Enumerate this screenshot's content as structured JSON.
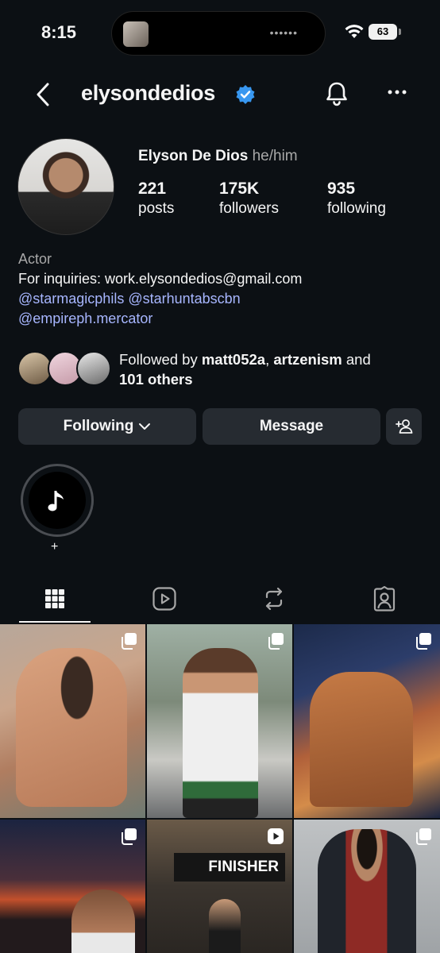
{
  "status_bar": {
    "time": "8:15",
    "battery": "63"
  },
  "header": {
    "username": "elysondedios"
  },
  "profile": {
    "name": "Elyson De Dios",
    "pronouns": "he/him",
    "stats": [
      {
        "value": "221",
        "label": "posts"
      },
      {
        "value": "175K",
        "label": "followers"
      },
      {
        "value": "935",
        "label": "following"
      }
    ]
  },
  "bio": {
    "category": "Actor",
    "line1": "For inquiries: work.elysondedios@gmail.com",
    "mention1": "@starmagicphils",
    "mention2": "@starhuntabscbn",
    "mention3": "@empireph.mercator"
  },
  "followed_by": {
    "prefix": "Followed by ",
    "user1": "matt052a",
    "sep": ", ",
    "user2": "artzenism",
    "and": " and",
    "others": "101 others"
  },
  "buttons": {
    "following": "Following",
    "message": "Message"
  },
  "highlight": {
    "label": "+"
  },
  "grid": {
    "posts": [
      {
        "type": "carousel"
      },
      {
        "type": "carousel"
      },
      {
        "type": "carousel"
      },
      {
        "type": "carousel"
      },
      {
        "type": "reel",
        "sign_text": "FINISHER"
      },
      {
        "type": "carousel"
      }
    ]
  },
  "colors": {
    "background": "#0c1014",
    "button": "#262b31",
    "link": "#a7b6ff",
    "verified": "#3897f0",
    "secondary_text": "#a8a8a8"
  },
  "icons": [
    "back-icon",
    "verified-icon",
    "bell-icon",
    "more-icon",
    "chevron-down-icon",
    "add-person-icon",
    "music-note-icon",
    "grid-icon",
    "reels-icon",
    "reposts-icon",
    "tagged-icon",
    "carousel-icon",
    "reel-icon"
  ]
}
